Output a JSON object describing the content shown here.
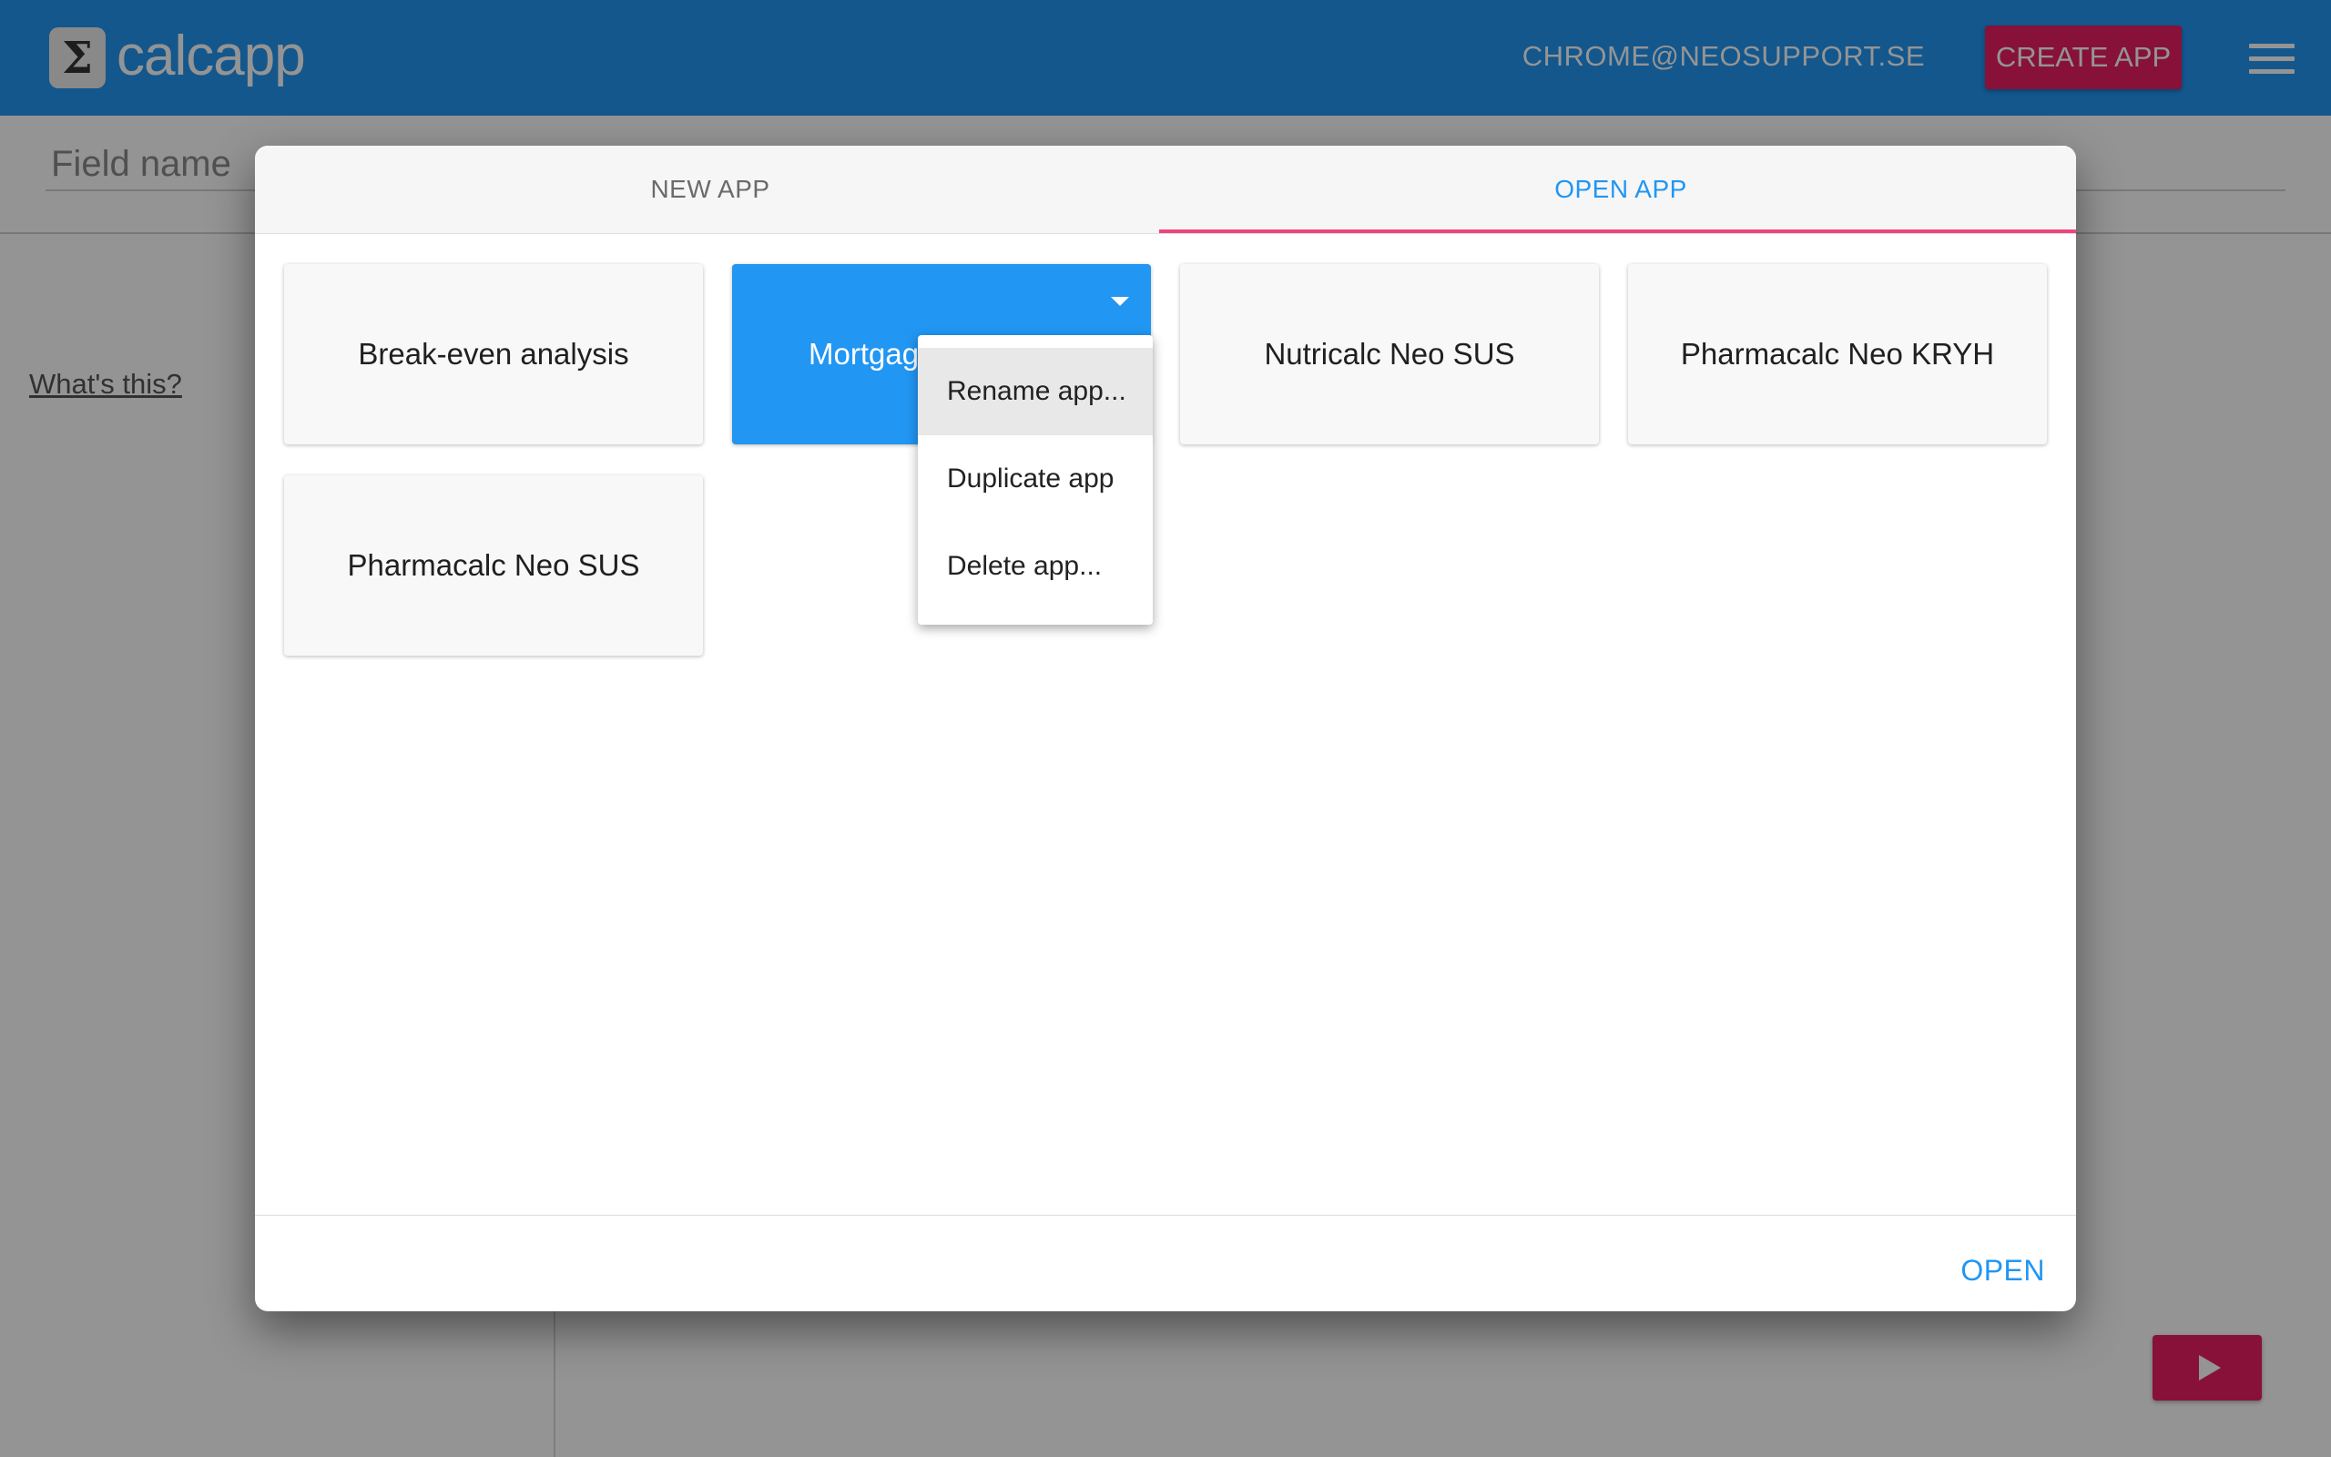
{
  "app": {
    "logo_glyph": "Σ",
    "name": "calcapp",
    "user_email": "CHROME@NEOSUPPORT.SE",
    "create_label": "CREATE APP",
    "field_placeholder": "Field name",
    "whats_this": "What's this?"
  },
  "dialog": {
    "tabs": [
      {
        "label": "NEW APP",
        "active": false
      },
      {
        "label": "OPEN APP",
        "active": true
      }
    ],
    "apps": [
      {
        "name": "Break-even analysis"
      },
      {
        "name": "Mortgag",
        "selected": true
      },
      {
        "name": "Nutricalc Neo SUS"
      },
      {
        "name": "Pharmacalc Neo KRYH"
      },
      {
        "name": "Pharmacalc Neo SUS"
      }
    ],
    "app_menu": {
      "items": [
        {
          "label": "Rename app...",
          "hover": true
        },
        {
          "label": "Duplicate app"
        },
        {
          "label": "Delete app..."
        }
      ]
    },
    "open_label": "OPEN"
  },
  "colors": {
    "primary": "#2196f3",
    "accent": "#e91e63",
    "tab_indicator": "#f0447a"
  }
}
